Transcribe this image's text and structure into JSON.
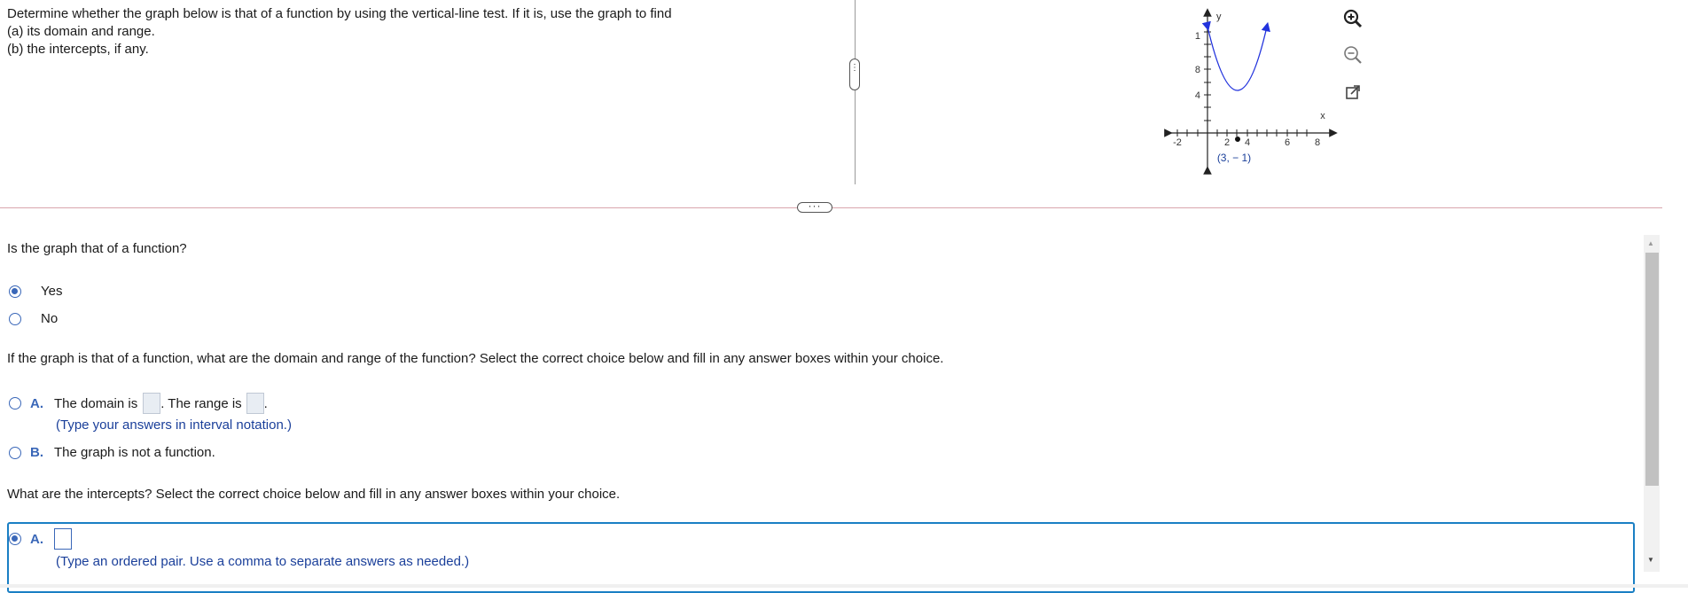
{
  "question": {
    "line1": "Determine whether the graph below is that of a function by using the vertical-line test.  If it is, use the graph to find",
    "line2": "(a)  its domain and range.",
    "line3": "(b)  the intercepts, if any."
  },
  "graph": {
    "axis_x_label": "x",
    "axis_y_label": "y",
    "x_ticks": [
      "-2",
      "2",
      "4",
      "6",
      "8"
    ],
    "y_ticks": [
      "4",
      "8",
      "1"
    ],
    "vertex_label": "(3, − 1)",
    "curve_color": "#2233dd"
  },
  "tools": {
    "zoom_in_icon": "zoom-in-icon",
    "zoom_out_icon": "zoom-out-icon",
    "popout_icon": "popout-icon"
  },
  "q1": {
    "prompt": "Is the graph that of a function?",
    "options": [
      {
        "label": "Yes",
        "selected": true
      },
      {
        "label": "No",
        "selected": false
      }
    ]
  },
  "q2": {
    "prompt": "If the graph is that of a function, what are the domain and range of the function? Select the correct choice below and fill in any answer boxes within your choice.",
    "optA_letter": "A.",
    "optA_text1": "The domain is",
    "optA_text2": ". The range is",
    "optA_text3": ".",
    "optA_hint": "(Type your answers in interval notation.)",
    "optB_letter": "B.",
    "optB_text": "The graph is not a function."
  },
  "q3": {
    "prompt": "What are the intercepts?   Select the correct choice below and fill in any answer boxes within your choice.",
    "optA_letter": "A.",
    "optA_hint": "(Type an ordered pair.  Use a comma to separate answers as needed.)"
  },
  "colors": {
    "accent": "#3a67b8",
    "selection_border": "#1a7fc4",
    "divider": "#d9a6ad"
  }
}
